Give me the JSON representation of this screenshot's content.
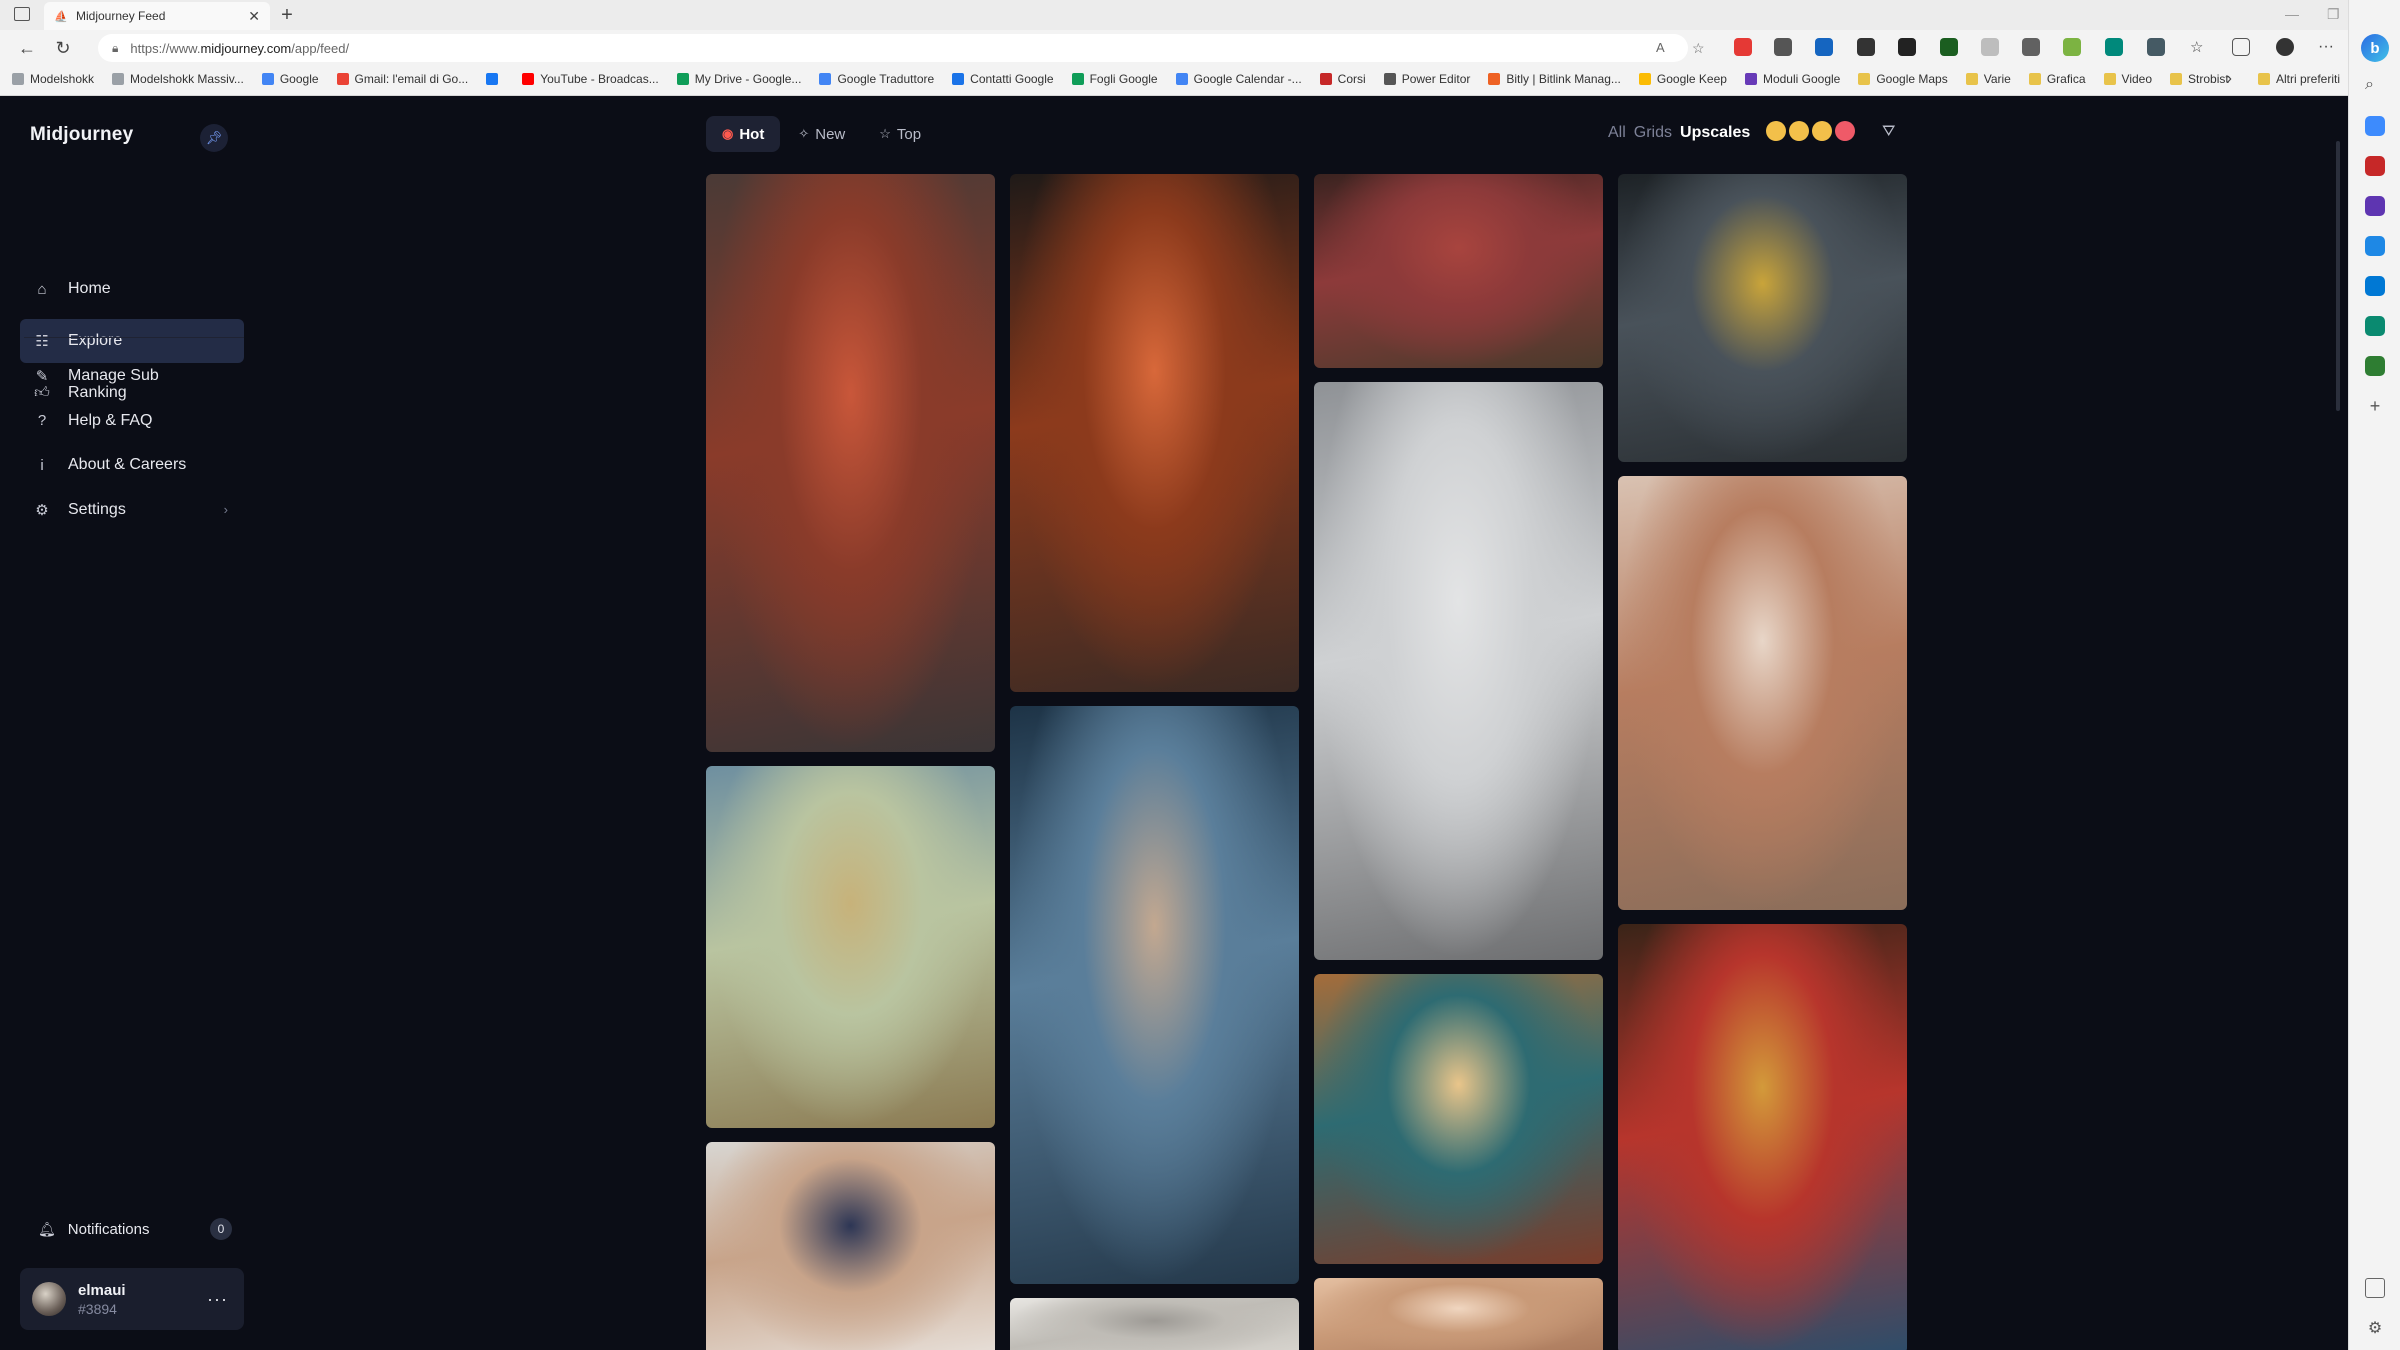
{
  "browser": {
    "tab_title": "Midjourney Feed",
    "new_tab": "+",
    "url_prefix": "https://www.",
    "url_domain": "midjourney.com",
    "url_path": "/app/feed/",
    "bookmarks": [
      {
        "label": "Modelshokk",
        "color": "#9aa0a6"
      },
      {
        "label": "Modelshokk Massiv...",
        "color": "#9aa0a6"
      },
      {
        "label": "Google",
        "color": "#4285f4"
      },
      {
        "label": "Gmail: l'email di Go...",
        "color": "#ea4335"
      },
      {
        "label": "",
        "color": "#1877f2"
      },
      {
        "label": "YouTube - Broadcas...",
        "color": "#ff0000"
      },
      {
        "label": "My Drive - Google...",
        "color": "#0f9d58"
      },
      {
        "label": "Google Traduttore",
        "color": "#4285f4"
      },
      {
        "label": "Contatti Google",
        "color": "#1a73e8"
      },
      {
        "label": "Fogli Google",
        "color": "#0f9d58"
      },
      {
        "label": "Google Calendar -...",
        "color": "#4285f4"
      },
      {
        "label": "Corsi",
        "color": "#c62828"
      },
      {
        "label": "Power Editor",
        "color": "#555555"
      },
      {
        "label": "Bitly | Bitlink Manag...",
        "color": "#ee6123"
      },
      {
        "label": "Google Keep",
        "color": "#fbbc04"
      },
      {
        "label": "Moduli Google",
        "color": "#673ab7"
      },
      {
        "label": "Google Maps",
        "color": "#e8c34a"
      },
      {
        "label": "Varie",
        "color": "#e8c34a"
      },
      {
        "label": "Grafica",
        "color": "#e8c34a"
      },
      {
        "label": "Video",
        "color": "#e8c34a"
      },
      {
        "label": "Strobist",
        "color": "#e8c34a"
      }
    ],
    "other_bookmarks": "Altri preferiti"
  },
  "sidebar": {
    "brand": "Midjourney",
    "nav": [
      {
        "label": "Home",
        "icon": "home-icon",
        "glyph": "⌂",
        "active": false
      },
      {
        "label": "Explore",
        "icon": "explore-icon",
        "glyph": "☷",
        "active": true
      },
      {
        "label": "Ranking",
        "icon": "thumbs-up-icon",
        "glyph": "👍︎",
        "active": false
      }
    ],
    "secondary": [
      {
        "label": "Manage Sub",
        "icon": "edit-icon",
        "glyph": "✎"
      },
      {
        "label": "Help & FAQ",
        "icon": "help-icon",
        "glyph": "?"
      },
      {
        "label": "About & Careers",
        "icon": "info-icon",
        "glyph": "i"
      },
      {
        "label": "Settings",
        "icon": "gear-icon",
        "glyph": "⚙"
      }
    ],
    "notifications_label": "Notifications",
    "notifications_count": "0",
    "user_name": "elmaui",
    "user_tag": "#3894",
    "more": "···"
  },
  "feed": {
    "filters": [
      {
        "label": "Hot",
        "active": true
      },
      {
        "label": "New",
        "active": false
      },
      {
        "label": "Top",
        "active": false
      }
    ],
    "views": [
      {
        "label": "All",
        "active": false
      },
      {
        "label": "Grids",
        "active": false
      },
      {
        "label": "Upscales",
        "active": true
      }
    ],
    "images": [
      {
        "subject": "woman in red armored suit on city street",
        "colors": [
          "#4a3a36",
          "#8a3b2a",
          "#c9573a",
          "#3a3536"
        ]
      },
      {
        "subject": "friendly green creature with lantern on beach",
        "colors": [
          "#6e8fa0",
          "#b9c4a0",
          "#c7b27a",
          "#8b7a52"
        ]
      },
      {
        "subject": "woman with navy headband",
        "colors": [
          "#d8d6d2",
          "#c8a48a",
          "#2d3655",
          "#e8e2dc"
        ]
      },
      {
        "subject": "red-haired woman portrait",
        "colors": [
          "#1f1a18",
          "#8c3a1c",
          "#d8683a",
          "#3a2a24"
        ]
      },
      {
        "subject": "woman portrait in blue ice light",
        "colors": [
          "#1d3346",
          "#5a7e9a",
          "#c3a890",
          "#24384a"
        ]
      },
      {
        "subject": "white porcelain sculpture",
        "colors": [
          "#e8e6e2",
          "#bfbcb6",
          "#9d9a95",
          "#d9d6d0"
        ]
      },
      {
        "subject": "raw beef steaks",
        "colors": [
          "#3a2320",
          "#8d3a3a",
          "#a8443e",
          "#4a3a2c"
        ]
      },
      {
        "subject": "woman in white robotic suit",
        "colors": [
          "#8f9296",
          "#cfd1d3",
          "#e3e4e5",
          "#6d6e70"
        ]
      },
      {
        "subject": "kingfisher painting",
        "colors": [
          "#a56c3a",
          "#2e6b72",
          "#e9c58a",
          "#7a3c2a"
        ]
      },
      {
        "subject": "woman face close-up",
        "colors": [
          "#e4bfa1",
          "#c99a78",
          "#f0d6c0",
          "#a8775a"
        ]
      },
      {
        "subject": "minion with staff",
        "colors": [
          "#1d2226",
          "#49525a",
          "#c9a43a",
          "#2a2f33"
        ]
      },
      {
        "subject": "fantasy girl in floral pastel",
        "colors": [
          "#d9c2b2",
          "#b77d60",
          "#e8d6c8",
          "#8a6d5a"
        ]
      },
      {
        "subject": "woman sorting colorful beads",
        "colors": [
          "#3a2418",
          "#b7352c",
          "#d39a3a",
          "#2d4d6a"
        ]
      }
    ]
  }
}
